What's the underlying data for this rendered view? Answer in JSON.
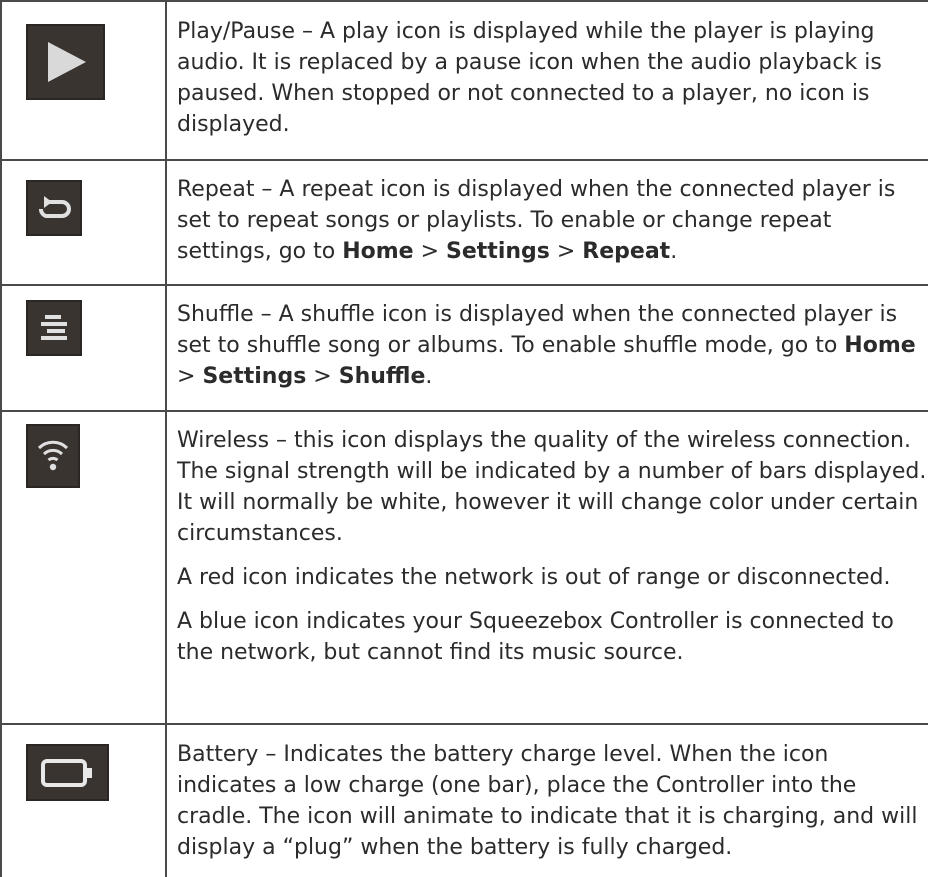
{
  "rows": [
    {
      "icon": "play-icon",
      "paragraphs": [
        {
          "text": "Play/Pause – A play icon is displayed while the player is playing audio. It is replaced by a pause icon when the audio playback is paused. When stopped or not connected to a player, no icon is displayed."
        }
      ]
    },
    {
      "icon": "repeat-icon",
      "paragraphs": [
        {
          "pre": "Repeat – A repeat icon is displayed when the connected player is set to repeat songs or playlists. To enable or change repeat settings, go to ",
          "b1": "Home",
          "sep1": " > ",
          "b2": "Settings",
          "sep2": " > ",
          "b3": "Repeat",
          "post": "."
        }
      ]
    },
    {
      "icon": "shuffle-icon",
      "paragraphs": [
        {
          "pre": "Shuffle – A shuffle icon is displayed when the connected player is set to shuffle song or albums. To enable shuffle mode, go to ",
          "b1": "Home",
          "sep1": " > ",
          "b2": "Settings",
          "sep2": " > ",
          "b3": "Shuffle",
          "post": "."
        }
      ]
    },
    {
      "icon": "wifi-icon",
      "paragraphs": [
        {
          "text": "Wireless – this icon displays the quality of the wireless connection. The signal strength will be indicated by a number of bars displayed. It will normally be white, however it will change color under certain circumstances."
        },
        {
          "text": "A red icon indicates the network is out of range or disconnected."
        },
        {
          "text": "A blue icon indicates your Squeezebox Controller is connected to the network, but cannot find its music source."
        }
      ]
    },
    {
      "icon": "battery-icon",
      "paragraphs": [
        {
          "text": "Battery – Indicates the battery charge level. When the icon indicates a low charge (one bar), place the Controller into the cradle. The icon will animate to indicate that it is charging, and will display a “plug” when the battery is fully charged."
        }
      ]
    }
  ]
}
